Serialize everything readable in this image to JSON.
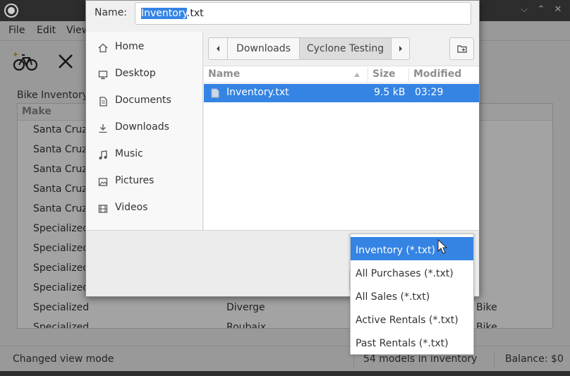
{
  "main": {
    "menu": [
      "File",
      "Edit",
      "View"
    ],
    "section_title": "Bike Inventory",
    "table": {
      "header_make": "Make",
      "rows": [
        [
          "Santa Cruz",
          "",
          ""
        ],
        [
          "Santa Cruz",
          "",
          ""
        ],
        [
          "Santa Cruz",
          "",
          ""
        ],
        [
          "Santa Cruz",
          "",
          ""
        ],
        [
          "Santa Cruz",
          "",
          ""
        ],
        [
          "Specialized",
          "",
          ""
        ],
        [
          "Specialized",
          "",
          ""
        ],
        [
          "Specialized",
          "",
          ""
        ],
        [
          "Specialized",
          "",
          ""
        ],
        [
          "Specialized",
          "Diverge",
          "Bike"
        ],
        [
          "Specialized",
          "Roubaix",
          "Bike"
        ]
      ]
    },
    "status": {
      "left": "Changed view mode",
      "middle": "54 models in inventory",
      "right": "Balance: $0"
    }
  },
  "dialog": {
    "name_label": "Name:",
    "name_value_selected": "Inventory",
    "name_value_rest": ".txt",
    "places": [
      {
        "label": "Home",
        "icon": "home-icon"
      },
      {
        "label": "Desktop",
        "icon": "desktop-icon"
      },
      {
        "label": "Documents",
        "icon": "documents-icon"
      },
      {
        "label": "Downloads",
        "icon": "downloads-icon"
      },
      {
        "label": "Music",
        "icon": "music-icon"
      },
      {
        "label": "Pictures",
        "icon": "pictures-icon"
      },
      {
        "label": "Videos",
        "icon": "videos-icon"
      }
    ],
    "path": [
      "Downloads",
      "Cyclone Testing"
    ],
    "columns": {
      "name": "Name",
      "size": "Size",
      "modified": "Modified"
    },
    "file": {
      "name": "Inventory.txt",
      "size": "9.5 kB",
      "modified": "03:29"
    },
    "filters": [
      "Inventory (*.txt)",
      "All Purchases (*.txt)",
      "All Sales (*.txt)",
      "Active Rentals (*.txt)",
      "Past Rentals (*.txt)"
    ],
    "selected_filter_index": 0
  },
  "colors": {
    "accent": "#3584e4",
    "titlebar": "#2d2d2d"
  }
}
